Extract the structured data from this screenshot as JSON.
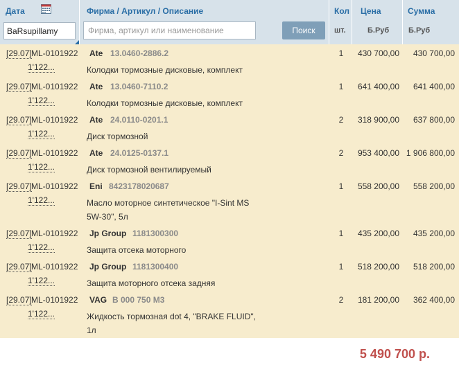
{
  "header": {
    "date_label": "Дата",
    "firm_label": "Фирма / Артикул / Описание",
    "qty_label": "Кол",
    "qty_unit": "шт.",
    "price_label": "Цена",
    "price_unit": "Б.Руб",
    "sum_label": "Сумма",
    "sum_unit": "Б.Руб",
    "date_input_value": "BaRsupillamy",
    "search_placeholder": "Фирма, артикул или наименование",
    "search_button": "Поиск"
  },
  "rows": [
    {
      "date": "[29.07]",
      "order": "ML-0101922",
      "num": "1'122...",
      "brand": "Ate",
      "article": "13.0460-2886.2",
      "desc": "Колодки тормозные дисковые, комплект",
      "qty": "1",
      "price": "430 700,00",
      "sum": "430 700,00"
    },
    {
      "date": "[29.07]",
      "order": "ML-0101922",
      "num": "1'122...",
      "brand": "Ate",
      "article": "13.0460-7110.2",
      "desc": "Колодки тормозные дисковые, комплект",
      "qty": "1",
      "price": "641 400,00",
      "sum": "641 400,00"
    },
    {
      "date": "[29.07]",
      "order": "ML-0101922",
      "num": "1'122...",
      "brand": "Ate",
      "article": "24.0110-0201.1",
      "desc": "Диск тормозной",
      "qty": "2",
      "price": "318 900,00",
      "sum": "637 800,00"
    },
    {
      "date": "[29.07]",
      "order": "ML-0101922",
      "num": "1'122...",
      "brand": "Ate",
      "article": "24.0125-0137.1",
      "desc": "Диск тормозной вентилируемый",
      "qty": "2",
      "price": "953 400,00",
      "sum": "1 906 800,00"
    },
    {
      "date": "[29.07]",
      "order": "ML-0101922",
      "num": "1'122...",
      "brand": "Eni",
      "article": "8423178020687",
      "desc": "Масло моторное синтетическое \"I-Sint MS 5W-30\", 5л",
      "qty": "1",
      "price": "558 200,00",
      "sum": "558 200,00"
    },
    {
      "date": "[29.07]",
      "order": "ML-0101922",
      "num": "1'122...",
      "brand": "Jp Group",
      "article": "1181300300",
      "desc": "Защита отсека моторного",
      "qty": "1",
      "price": "435 200,00",
      "sum": "435 200,00"
    },
    {
      "date": "[29.07]",
      "order": "ML-0101922",
      "num": "1'122...",
      "brand": "Jp Group",
      "article": "1181300400",
      "desc": "Защита моторного отсека задняя",
      "qty": "1",
      "price": "518 200,00",
      "sum": "518 200,00"
    },
    {
      "date": "[29.07]",
      "order": "ML-0101922",
      "num": "1'122...",
      "brand": "VAG",
      "article": "B 000 750 M3",
      "desc": "Жидкость тормозная dot 4, \"BRAKE FLUID\", 1л",
      "qty": "2",
      "price": "181 200,00",
      "sum": "362 400,00"
    }
  ],
  "total": "5 490 700 р."
}
